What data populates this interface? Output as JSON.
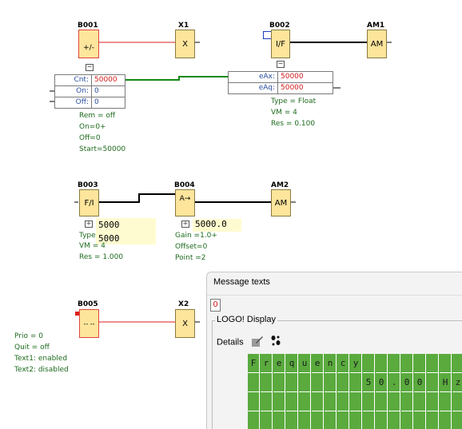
{
  "blocks": {
    "b001": {
      "label": "B001",
      "symbol": "+/-"
    },
    "x1": {
      "label": "X1",
      "symbol": "X"
    },
    "b002": {
      "label": "B002",
      "symbol": "I/F"
    },
    "am1": {
      "label": "AM1",
      "symbol": "AM"
    },
    "b003": {
      "label": "B003",
      "symbol": "F/I"
    },
    "b004": {
      "label": "B004",
      "symbol": "A→"
    },
    "am2": {
      "label": "AM2",
      "symbol": "AM"
    },
    "b005": {
      "label": "B005",
      "symbol": "-- --"
    },
    "x2": {
      "label": "X2",
      "symbol": "X"
    }
  },
  "b001_params": {
    "cnt_key": "Cnt:",
    "cnt_val": "50000",
    "on_key": "On:",
    "on_val": "0",
    "off_key": "Off:",
    "off_val": "0",
    "info": [
      "Rem = off",
      "On=0+",
      "Off=0",
      "Start=50000"
    ]
  },
  "b002_params": {
    "eax_key": "eAx:",
    "eax_val": "50000",
    "eaq_key": "eAq:",
    "eaq_val": "50000",
    "info": [
      "Type = Float",
      "VM = 4",
      "Res = 0.100"
    ]
  },
  "b003_params": {
    "val1": "5000",
    "type_label": "Type",
    "val2": "5000",
    "info": [
      "VM = 4",
      "Res = 1.000"
    ]
  },
  "b004_params": {
    "val": "5000.0",
    "info": [
      "Gain  =1.0+",
      "Offset=0",
      "Point =2"
    ]
  },
  "b005_params": {
    "info": [
      "Prio = 0",
      "Quit = off",
      "Text1: enabled",
      "Text2: disabled"
    ]
  },
  "message_panel": {
    "title": "Message texts",
    "tab_index": "0",
    "group_title": "LOGO! Display",
    "details_label": "Details",
    "display_row1": [
      "F",
      "r",
      "e",
      "q",
      "u",
      "e",
      "n",
      "c",
      "y",
      "",
      "",
      "",
      "",
      "",
      "",
      "",
      ""
    ],
    "display_row2": [
      "",
      "",
      "",
      "",
      "",
      "",
      "",
      "",
      "",
      "5",
      "0",
      ".",
      "0",
      "0",
      "",
      "H",
      "z"
    ]
  }
}
